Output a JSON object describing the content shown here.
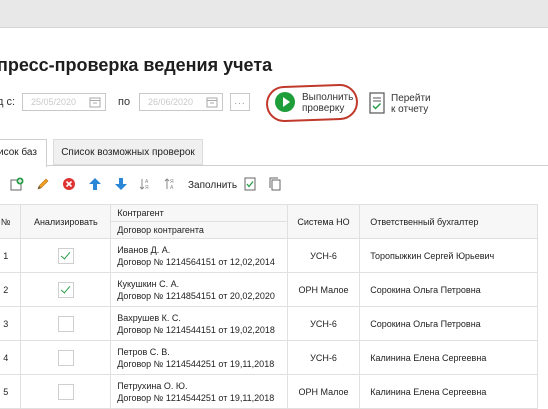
{
  "page": {
    "title": "пресс-проверка ведения учета"
  },
  "period": {
    "from_label": "д с:",
    "from_value": "25/05/2020",
    "to_label": "по",
    "to_value": "26/06/2020",
    "more_label": "..."
  },
  "actions": {
    "run_label_1": "Выполнить",
    "run_label_2": "проверку",
    "report_label_1": "Перейти",
    "report_label_2": "к отчету"
  },
  "tabs": [
    {
      "label": "исок баз",
      "active": true
    },
    {
      "label": "Список возможных проверок",
      "active": false
    }
  ],
  "toolbar": {
    "icons": [
      "add-icon",
      "edit-icon",
      "delete-icon",
      "move-up-icon",
      "move-down-icon",
      "sort-asc-icon",
      "sort-desc-icon",
      "fill-check-icon",
      "fill-copy-icon"
    ],
    "fill_label": "Заполнить"
  },
  "table": {
    "headers": {
      "no": "№",
      "analyze": "Анализировать",
      "contractor": "Контрагент",
      "contract": "Договор контрагента",
      "tax_system": "Система НО",
      "accountant": "Ответственный бухгалтер"
    },
    "rows": [
      {
        "no": "1",
        "checked": true,
        "name": "Иванов Д. А.",
        "contract": "Договор № 1214564151 от 12,02,2014",
        "tax": "УСН-6",
        "accountant": "Торопыжкин Сергей Юрьевич"
      },
      {
        "no": "2",
        "checked": true,
        "name": "Кукушкин С. А.",
        "contract": "Договор № 1214854151 от 20,02,2020",
        "tax": "ОРН Малое",
        "accountant": "Сорокина Ольга Петровна"
      },
      {
        "no": "3",
        "checked": false,
        "name": "Вахрушев К. С.",
        "contract": "Договор № 1214544151 от 19,02,2018",
        "tax": "УСН-6",
        "accountant": "Сорокина Ольга Петровна"
      },
      {
        "no": "4",
        "checked": false,
        "name": "Петров С. В.",
        "contract": "Договор № 1214544251 от 19,11,2018",
        "tax": "УСН-6",
        "accountant": "Калинина Елена Сергеевна"
      },
      {
        "no": "5",
        "checked": false,
        "name": "Петрухина О. Ю.",
        "contract": "Договор № 1214544251 от 19,11,2018",
        "tax": "ОРН Малое",
        "accountant": "Калинина Елена Сергеевна"
      }
    ]
  }
}
